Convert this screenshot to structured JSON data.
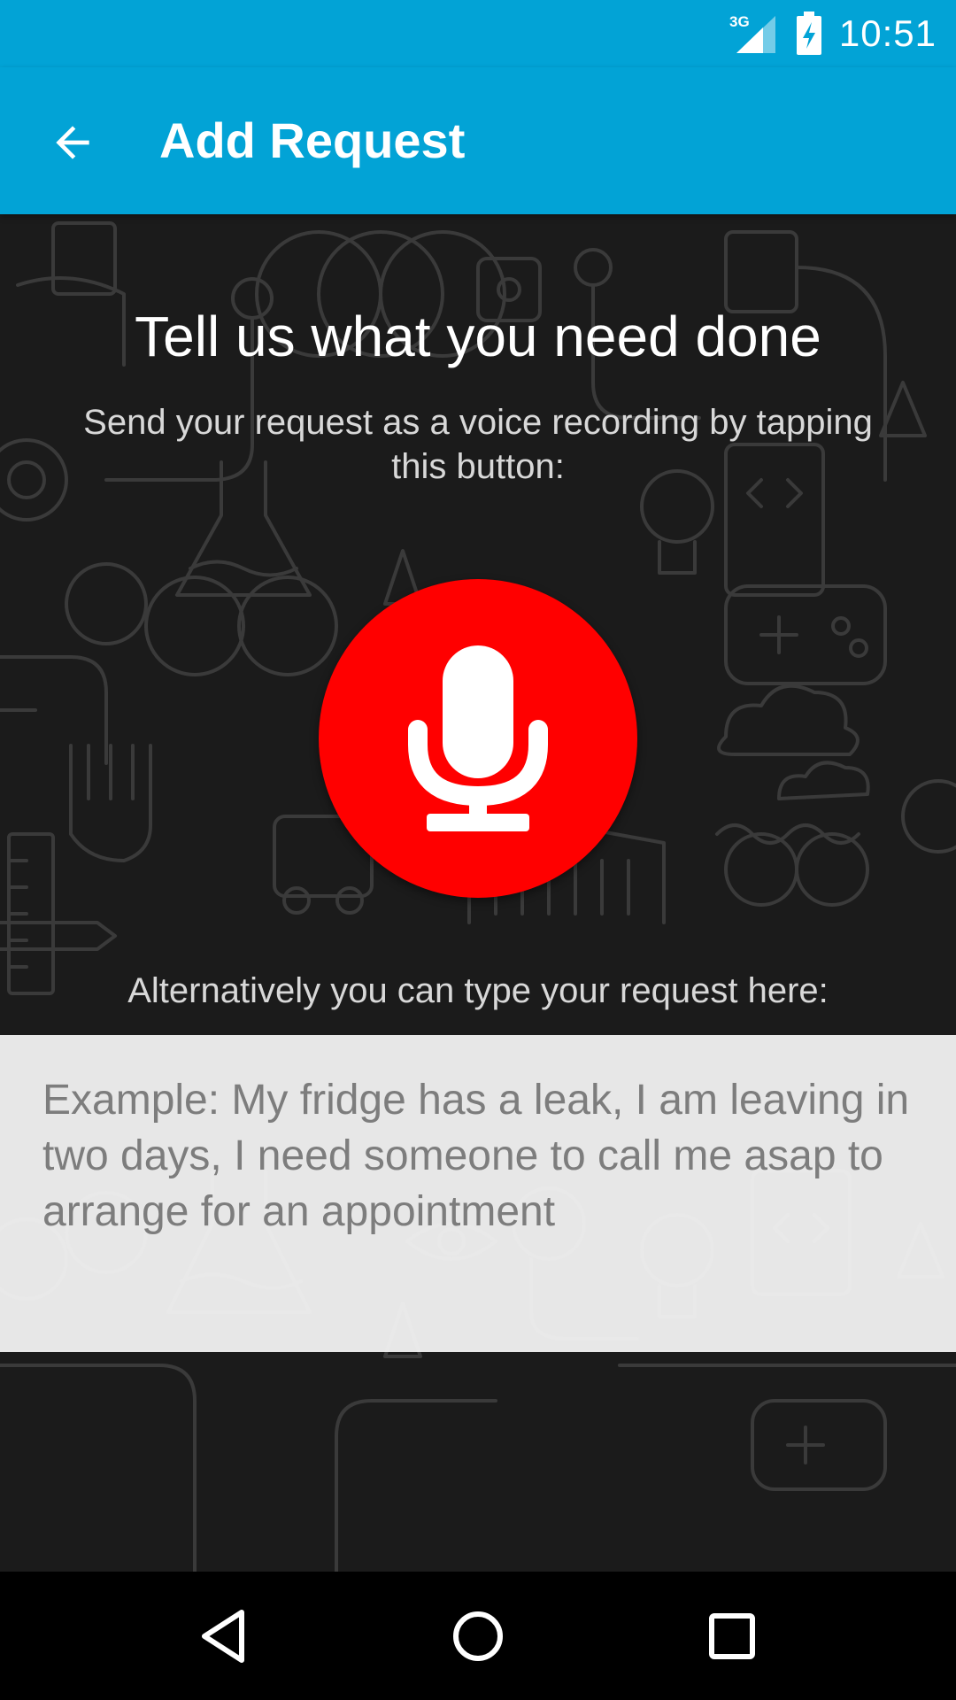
{
  "status_bar": {
    "network": "3G",
    "time": "10:51"
  },
  "app_bar": {
    "title": "Add Request",
    "back_icon": "arrow-back-icon"
  },
  "main": {
    "headline": "Tell us what you need done",
    "instructions": "Send your request as a voice recording by tapping this button:",
    "record_icon": "microphone-icon",
    "alternative_text": "Alternatively you can type your request here:",
    "request_input": {
      "value": "",
      "placeholder": "Example: My fridge has a leak, I am leaving in two days, I need someone to call me asap to arrange for an appointment"
    }
  },
  "nav_bar": {
    "back_icon": "nav-back-icon",
    "home_icon": "nav-home-icon",
    "recents_icon": "nav-recents-icon"
  },
  "colors": {
    "primary": "#02a3d6",
    "record_button": "#ff0000",
    "background": "#1b1b1b",
    "input_background": "#eeeeee",
    "placeholder_text": "#7d7d7d"
  }
}
